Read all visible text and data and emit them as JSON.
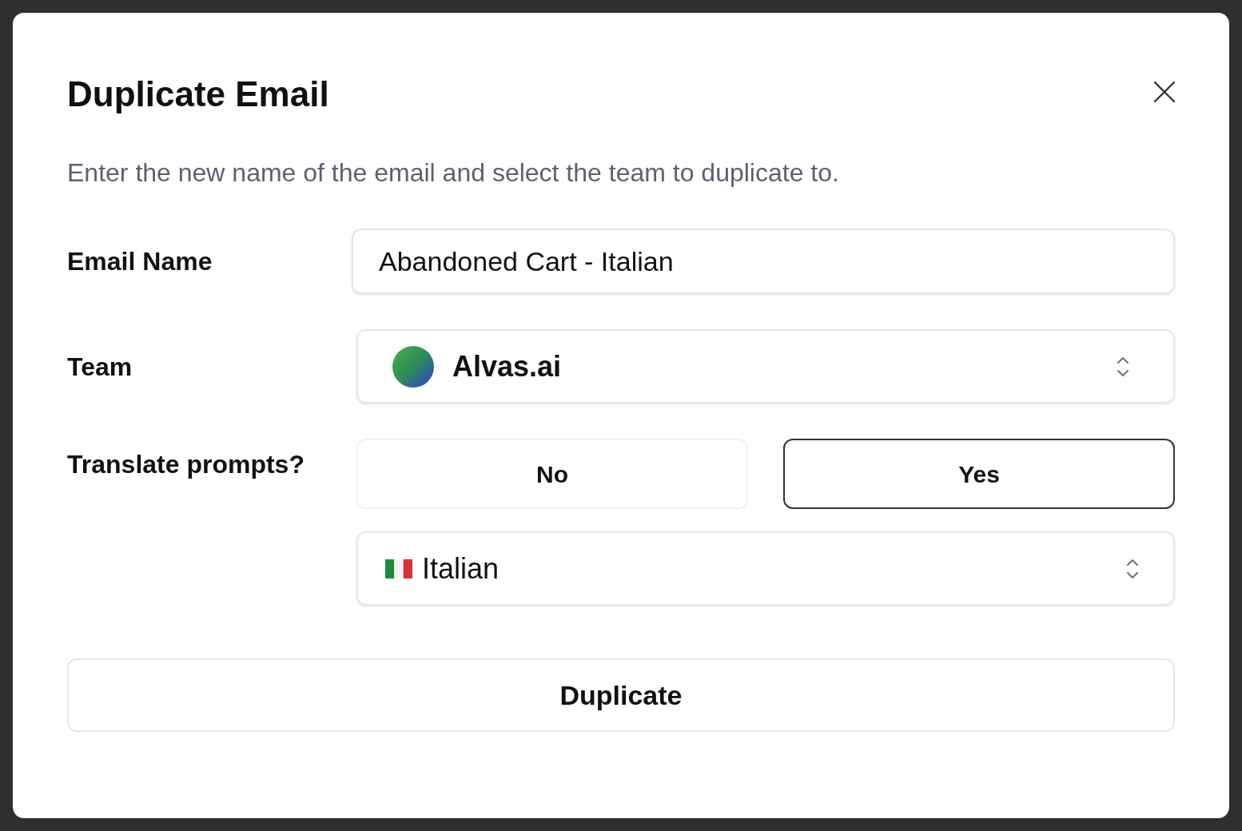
{
  "dialog": {
    "title": "Duplicate Email",
    "description": "Enter the new name of the email and select the team to duplicate to."
  },
  "email_name": {
    "label": "Email Name",
    "value": "Abandoned Cart - Italian"
  },
  "team": {
    "label": "Team",
    "value": "Alvas.ai"
  },
  "translate": {
    "label": "Translate prompts?",
    "options": [
      {
        "label": "No",
        "selected": false
      },
      {
        "label": "Yes",
        "selected": true
      }
    ]
  },
  "language": {
    "value": "Italian"
  },
  "submit": "Duplicate"
}
